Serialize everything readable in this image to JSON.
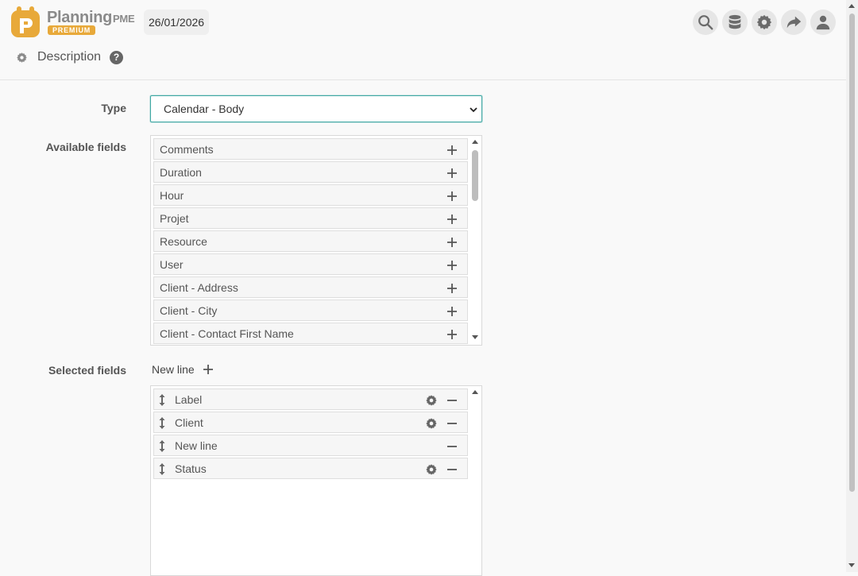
{
  "header": {
    "logo_name": "Planning",
    "logo_suffix": "PME",
    "logo_badge": "PREMIUM",
    "date": "26/01/2026",
    "tools": [
      {
        "name": "search-icon"
      },
      {
        "name": "database-icon"
      },
      {
        "name": "gear-icon"
      },
      {
        "name": "share-icon"
      },
      {
        "name": "user-icon"
      }
    ]
  },
  "section": {
    "title": "Description",
    "help": "?"
  },
  "form": {
    "type_label": "Type",
    "type_value": "Calendar - Body",
    "available_label": "Available fields",
    "selected_label": "Selected fields",
    "new_line_label": "New line"
  },
  "available_fields": [
    "Comments",
    "Duration",
    "Hour",
    "Projet",
    "Resource",
    "User",
    "Client - Address",
    "Client - City",
    "Client - Contact First Name"
  ],
  "selected_fields": [
    {
      "label": "Label",
      "settings": true
    },
    {
      "label": "Client",
      "settings": true
    },
    {
      "label": "New line",
      "settings": false
    },
    {
      "label": "Status",
      "settings": true
    }
  ],
  "colors": {
    "accent": "#40a8a4",
    "brand": "#e8a93a",
    "icon": "#6b6b6b"
  }
}
